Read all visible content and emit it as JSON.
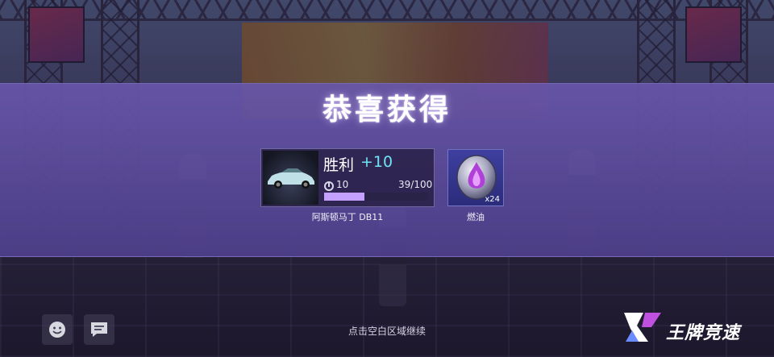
{
  "title": "恭喜获得",
  "car_reward": {
    "result_label": "胜利",
    "bonus": "+10",
    "level": "10",
    "progress_text": "39/100",
    "progress_fraction": 0.39,
    "car_name": "阿斯顿马丁 DB11"
  },
  "item_reward": {
    "count": "x24",
    "name": "燃油"
  },
  "hint": "点击空白区域继续",
  "logo": {
    "text": "王牌竞速"
  },
  "icons": {
    "emoji": "emoji-icon",
    "chat": "chat-icon",
    "level": "speedometer-icon",
    "fuel": "fuel-icon"
  },
  "colors": {
    "band": "#5c4c9c",
    "bonus": "#6fe2f5",
    "xp_fill": "#c4a0ff",
    "fuel_card": "#3e3fa0"
  }
}
